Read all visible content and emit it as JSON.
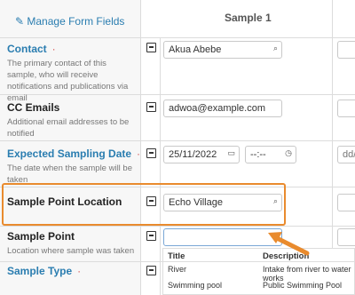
{
  "header": {
    "manage_link": "✎ Manage Form Fields",
    "column_title": "Sample 1"
  },
  "fields": [
    {
      "title": "Contact",
      "required": "·",
      "description": "The primary contact of this sample, who will receive notifications and publications via email",
      "value": "Akua Abebe"
    },
    {
      "title": "CC Emails",
      "description": "Additional email addresses to be notified",
      "value": "adwoa@example.com"
    },
    {
      "title": "Expected Sampling Date",
      "required": "·",
      "description": "The date when the sample will be taken",
      "date_value": "25/11/2022",
      "time_value": "--:--",
      "next_column_placeholder": "dd/"
    },
    {
      "title": "Sample Point Location",
      "value": "Echo Village"
    },
    {
      "title": "Sample Point",
      "description": "Location where sample was taken",
      "value": ""
    },
    {
      "title": "Sample Type",
      "required": "·"
    }
  ],
  "dropdown": {
    "headers": [
      "Title",
      "Description"
    ],
    "rows": [
      {
        "title": "River",
        "description": "Intake from river to water works"
      },
      {
        "title": "Swimming pool",
        "description": "Public Swimming Pool"
      }
    ]
  },
  "colors": {
    "link": "#2a7db0",
    "required": "#d9534f",
    "highlight": "#e98b2e"
  }
}
